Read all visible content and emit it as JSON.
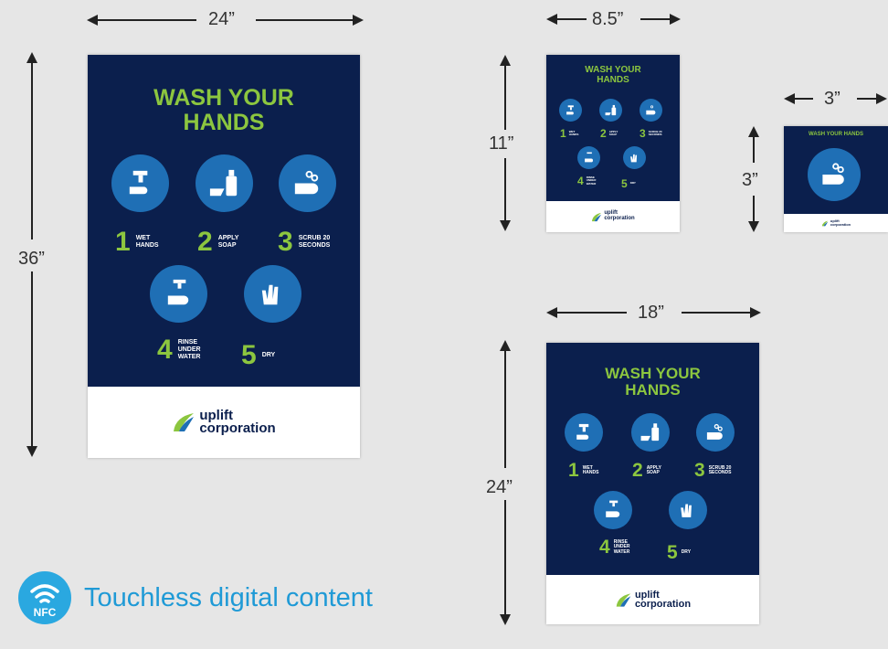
{
  "dimensions": {
    "large": {
      "width": "24”",
      "height": "36”"
    },
    "small": {
      "width": "8.5”",
      "height": "11”"
    },
    "mini": {
      "width": "3”",
      "height": "3”"
    },
    "medium": {
      "width": "18”",
      "height": "24”"
    }
  },
  "poster": {
    "title": "WASH YOUR\nHANDS",
    "steps": [
      {
        "num": "1",
        "label": "WET\nHANDS"
      },
      {
        "num": "2",
        "label": "APPLY\nSOAP"
      },
      {
        "num": "3",
        "label": "SCRUB 20\nSECONDS"
      },
      {
        "num": "4",
        "label": "RINSE\nUNDER\nWATER"
      },
      {
        "num": "5",
        "label": "DRY"
      }
    ],
    "mini_title": "WASH YOUR HANDS",
    "logo_line1": "uplift",
    "logo_line2": "corporation"
  },
  "nfc": {
    "badge": "NFC",
    "text": "Touchless digital content"
  },
  "colors": {
    "navy": "#0b1f4d",
    "green": "#8cc63f",
    "icon_blue": "#1f6fb5",
    "nfc_blue": "#1f9ad6"
  }
}
